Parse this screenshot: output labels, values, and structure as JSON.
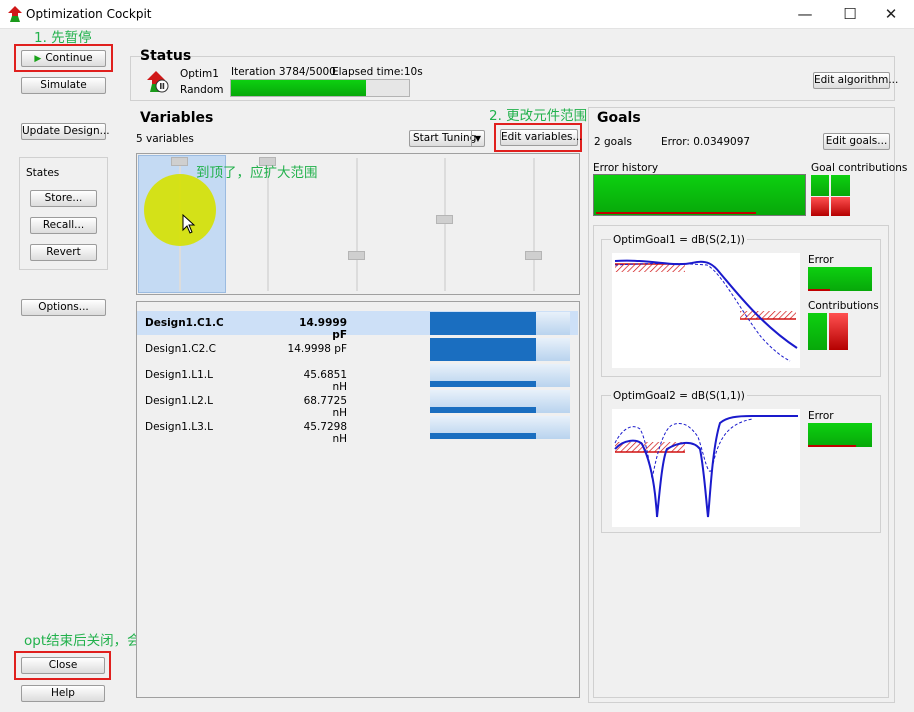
{
  "window": {
    "title": "Optimization Cockpit",
    "minimize": "—",
    "maximize": "☐",
    "close": "✕"
  },
  "left": {
    "continue": "Continue",
    "simulate": "Simulate",
    "update_design": "Update Design...",
    "states_label": "States",
    "store": "Store...",
    "recall": "Recall...",
    "revert": "Revert",
    "options": "Options...",
    "close": "Close",
    "help": "Help"
  },
  "annotations": {
    "a1": "1. 先暂停",
    "a2": "2. 更改元件范围",
    "a3": "到顶了，应扩大范围",
    "a4": "opt结束后关闭，会提示update opt结果"
  },
  "status": {
    "title": "Status",
    "optim": "Optim1",
    "algorithm": "Random",
    "iteration": "Iteration 3784/5000",
    "elapsed": "Elapsed time:10s",
    "progress": 0.757,
    "edit_algorithm": "Edit algorithm..."
  },
  "variables": {
    "title": "Variables",
    "count": "5 variables",
    "start_tuning": "Start Tuning",
    "edit_variables": "Edit variables...",
    "rows": [
      {
        "name": "Design1.C1.C",
        "value": "14.9999 pF",
        "fill": 0.76
      },
      {
        "name": "Design1.C2.C",
        "value": "14.9998 pF",
        "fill": 0.76
      },
      {
        "name": "Design1.L1.L",
        "value": "45.6851 nH",
        "fill": 0.76
      },
      {
        "name": "Design1.L2.L",
        "value": "68.7725 nH",
        "fill": 0.76
      },
      {
        "name": "Design1.L3.L",
        "value": "45.7298 nH",
        "fill": 0.76
      }
    ]
  },
  "goals": {
    "title": "Goals",
    "count": "2 goals",
    "error": "Error:  0.0349097",
    "edit_goals": "Edit goals...",
    "error_history": "Error history",
    "goal_contributions": "Goal contributions",
    "goal1": {
      "title": "OptimGoal1 = dB(S(2,1))",
      "error_label": "Error",
      "contrib_label": "Contributions"
    },
    "goal2": {
      "title": "OptimGoal2 = dB(S(1,1))",
      "error_label": "Error"
    }
  }
}
